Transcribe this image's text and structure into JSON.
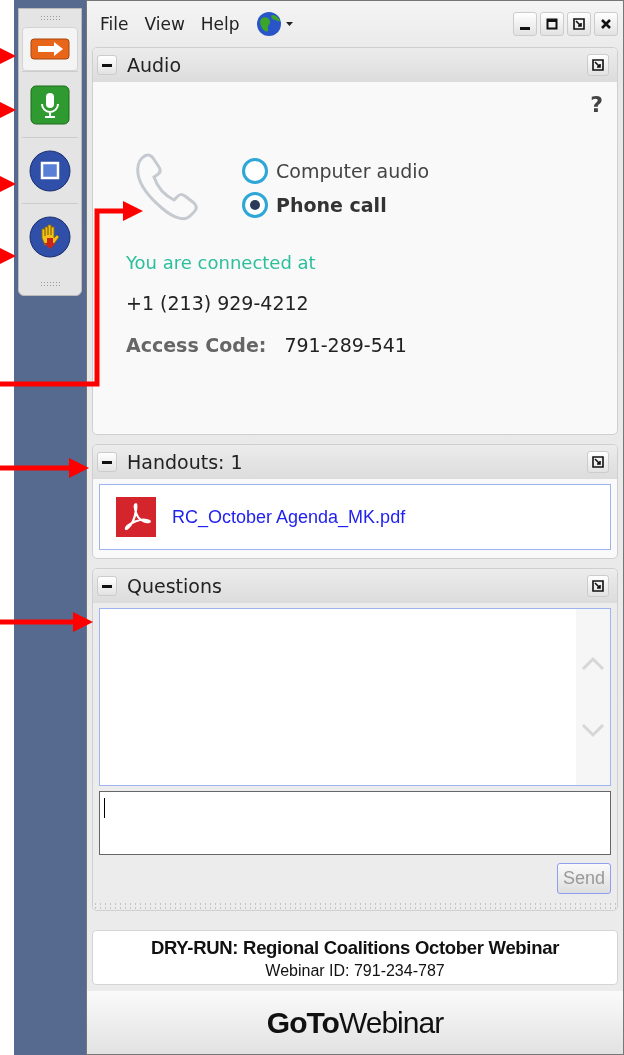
{
  "menu": [
    {
      "label": "File"
    },
    {
      "label": "View"
    },
    {
      "label": "Help"
    }
  ],
  "audio": {
    "title": "Audio",
    "expanded": true,
    "help": "?",
    "options": [
      {
        "label": "Computer audio",
        "selected": false
      },
      {
        "label": "Phone call",
        "selected": true
      }
    ],
    "status": "You are connected at",
    "phone": "+1 (213) 929-4212",
    "access_label": "Access Code:",
    "access_code": "791-289-541"
  },
  "handouts": {
    "title": "Handouts: 1",
    "expanded": true,
    "files": [
      {
        "name": "RC_October Agenda_MK.pdf"
      }
    ]
  },
  "questions": {
    "title": "Questions",
    "expanded": true,
    "send_button": {
      "label": "Send",
      "disabled": true
    }
  },
  "footer": {
    "title": "DRY-RUN: Regional Coalitions October Webinar",
    "webinar_id": "Webinar ID: 791-234-787",
    "logo": "**GoTo**Webinar"
  }
}
